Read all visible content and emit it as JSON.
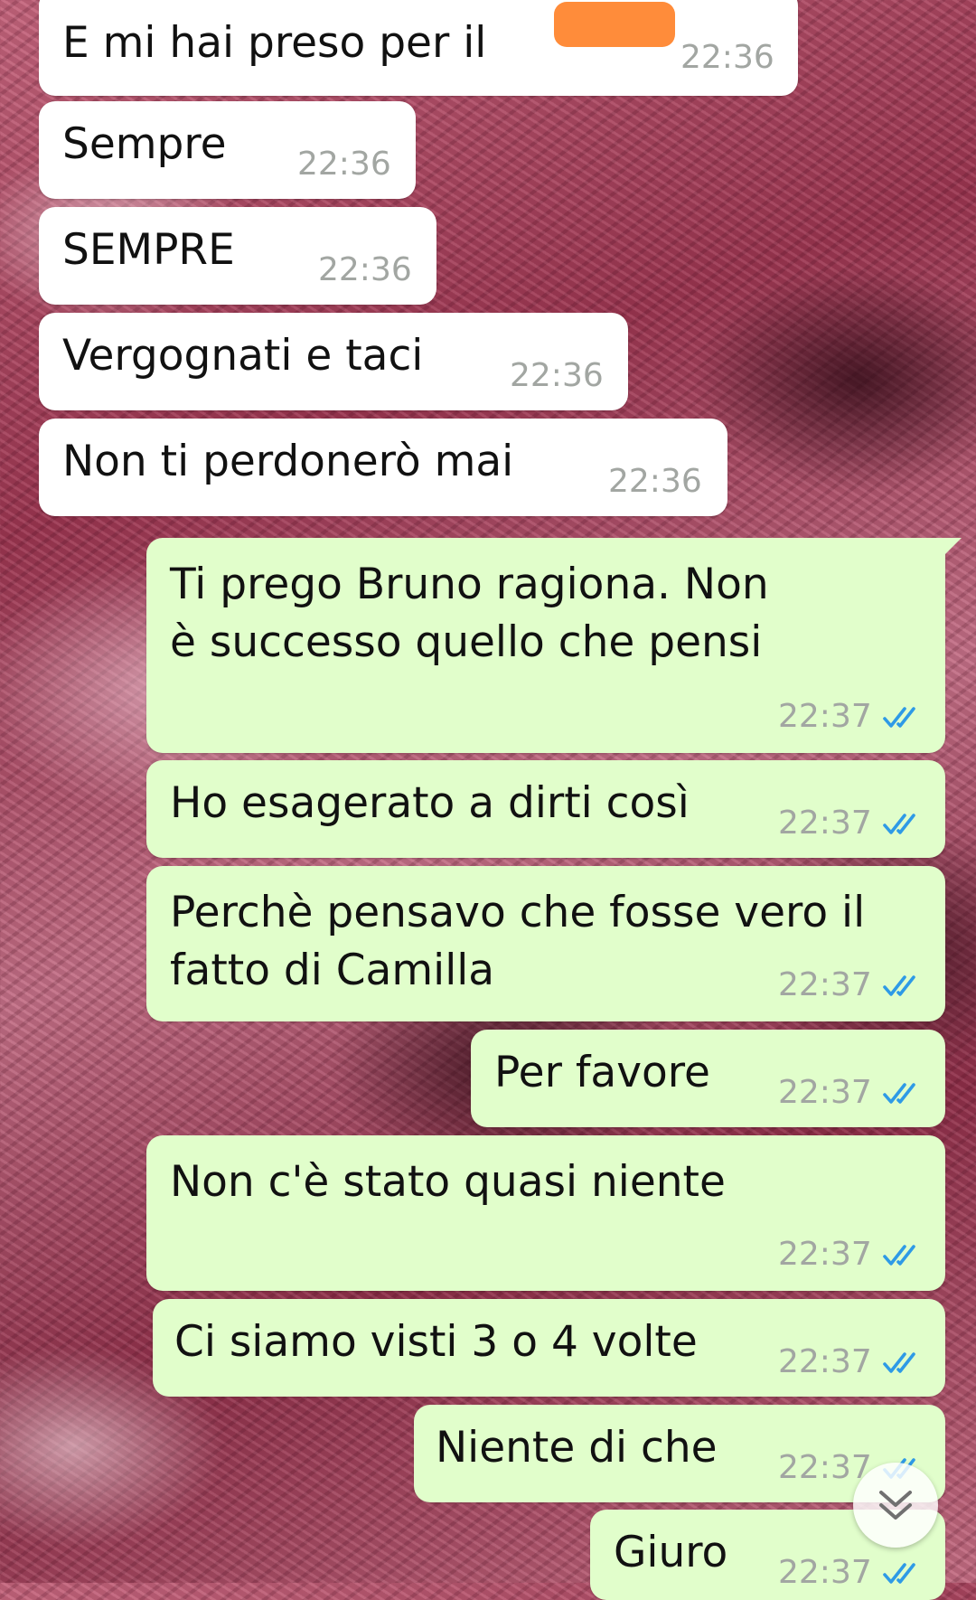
{
  "chat": {
    "incoming": [
      {
        "text": "E mi hai preso per il",
        "time": "22:36"
      },
      {
        "text": "Sempre",
        "time": "22:36"
      },
      {
        "text": "SEMPRE",
        "time": "22:36"
      },
      {
        "text": "Vergognati e taci",
        "time": "22:36"
      },
      {
        "text": "Non ti perdonerò mai",
        "time": "22:36"
      }
    ],
    "outgoing": [
      {
        "line1": "Ti prego Bruno ragiona. Non",
        "line2": "è successo quello che pensi",
        "time": "22:37"
      },
      {
        "text": "Ho esagerato a dirti così",
        "time": "22:37"
      },
      {
        "line1": "Perchè pensavo che fosse vero il",
        "line2": "fatto di Camilla",
        "time": "22:37"
      },
      {
        "text": "Per favore",
        "time": "22:37"
      },
      {
        "text": "Non c'è stato quasi niente",
        "time": "22:37"
      },
      {
        "text": "Ci siamo visti 3 o 4 volte",
        "time": "22:37"
      },
      {
        "text": "Niente di che",
        "time": "22:37"
      },
      {
        "text": "Giuro",
        "time": "22:37"
      }
    ]
  },
  "colors": {
    "incoming_bubble": "#ffffff",
    "outgoing_bubble": "#e1fecb",
    "read_ticks": "#2e9ae6",
    "redaction": "#ff8c3a"
  },
  "icons": {
    "read_receipt": "double-check-icon",
    "scroll_down": "double-chevron-down-icon"
  }
}
